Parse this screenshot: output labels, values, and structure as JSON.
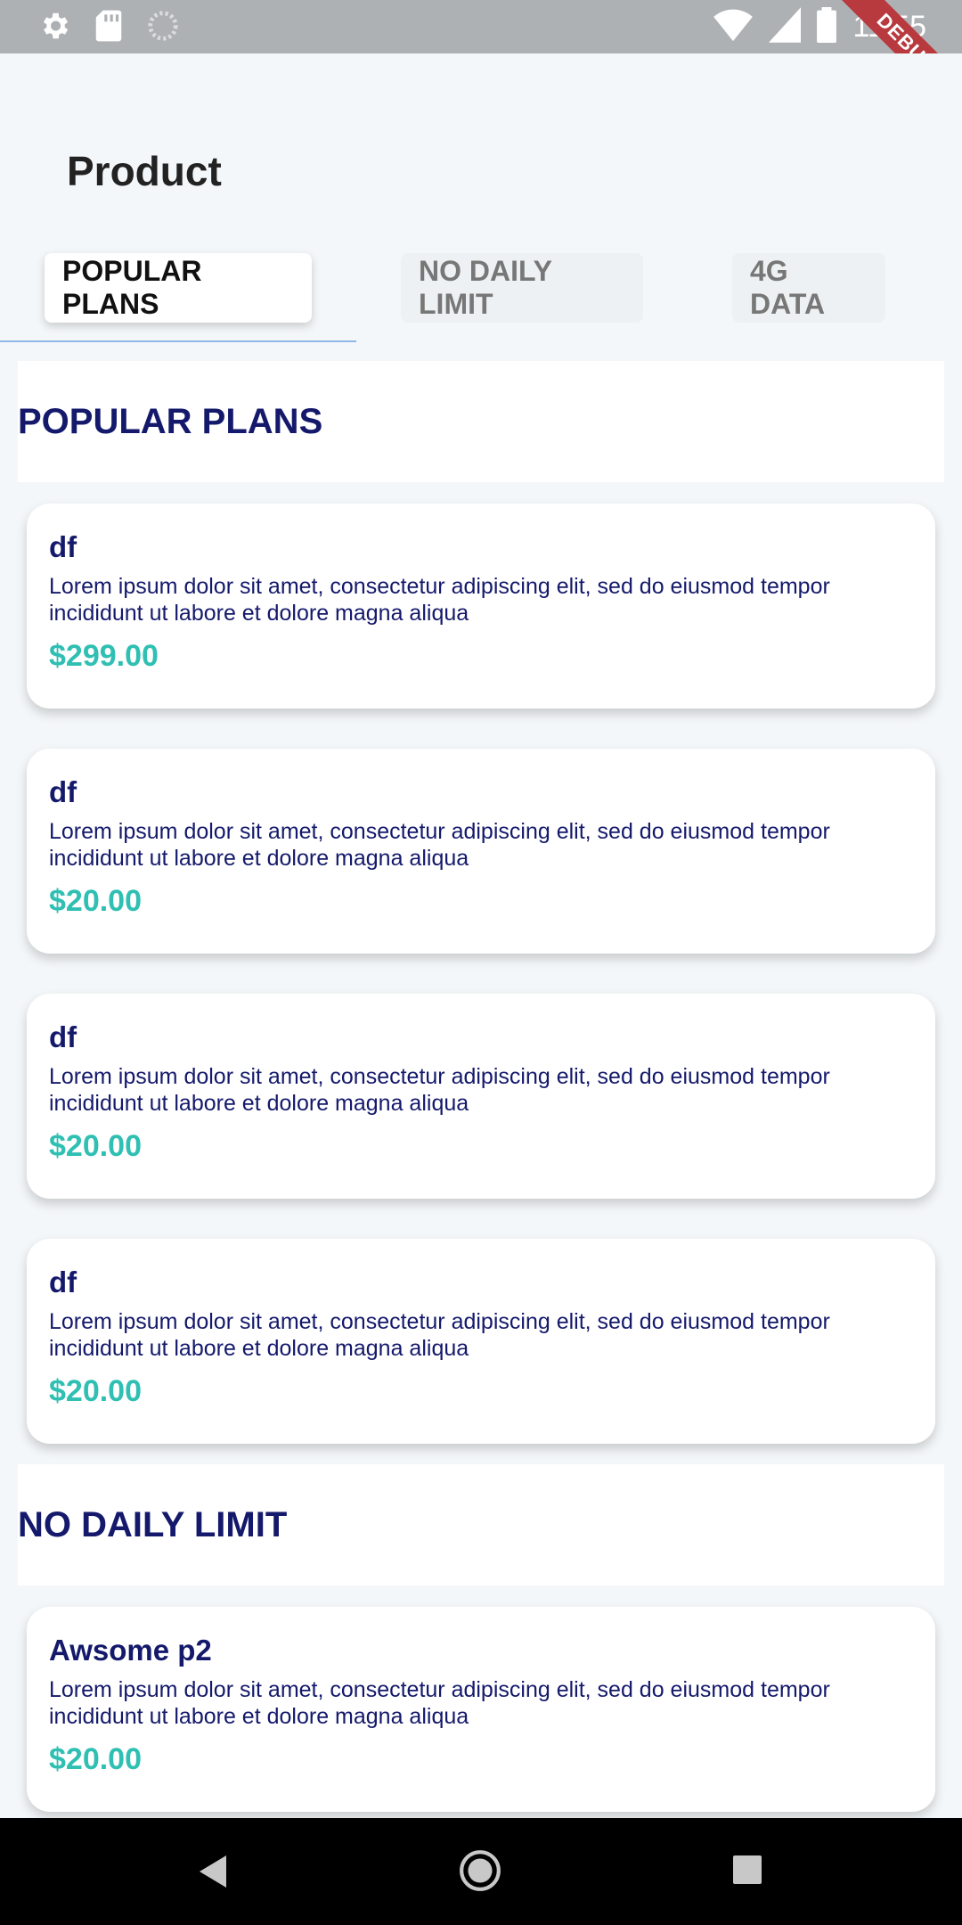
{
  "status_bar": {
    "time": "11:55",
    "left_icons": [
      "gear-icon",
      "sd-card-icon",
      "circle-icon"
    ],
    "right_icons": [
      "wifi-icon",
      "signal-icon",
      "battery-icon"
    ],
    "debug_label": "DEBUG"
  },
  "header": {
    "title": "Product"
  },
  "tabs": [
    {
      "label": "POPULAR PLANS",
      "active": true
    },
    {
      "label": "NO DAILY LIMIT",
      "active": false
    },
    {
      "label": "4G DATA",
      "active": false
    }
  ],
  "sections": [
    {
      "title": "POPULAR PLANS",
      "cards": [
        {
          "name": "df",
          "description": "Lorem ipsum dolor sit amet, consectetur adipiscing elit, sed do eiusmod tempor incididunt ut labore et dolore magna aliqua",
          "price": "$299.00"
        },
        {
          "name": "df",
          "description": "Lorem ipsum dolor sit amet, consectetur adipiscing elit, sed do eiusmod tempor incididunt ut labore et dolore magna aliqua",
          "price": "$20.00"
        },
        {
          "name": "df",
          "description": "Lorem ipsum dolor sit amet, consectetur adipiscing elit, sed do eiusmod tempor incididunt ut labore et dolore magna aliqua",
          "price": "$20.00"
        },
        {
          "name": "df",
          "description": "Lorem ipsum dolor sit amet, consectetur adipiscing elit, sed do eiusmod tempor incididunt ut labore et dolore magna aliqua",
          "price": "$20.00"
        }
      ]
    },
    {
      "title": "NO DAILY LIMIT",
      "cards": [
        {
          "name": "Awsome p2",
          "description": "Lorem ipsum dolor sit amet, consectetur adipiscing elit, sed do eiusmod tempor incididunt ut labore et dolore magna aliqua",
          "price": "$20.00"
        }
      ]
    }
  ],
  "nav_bar": {
    "buttons": [
      "back-icon",
      "home-icon",
      "recents-icon"
    ]
  },
  "colors": {
    "accent_navy": "#14196b",
    "price_teal": "#2fbfb3",
    "status_bar": "#aeb1b4"
  }
}
